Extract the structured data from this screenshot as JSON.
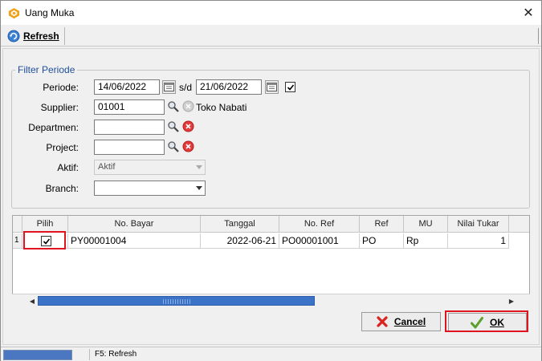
{
  "window": {
    "title": "Uang Muka",
    "close_glyph": "✕"
  },
  "toolbar": {
    "refresh_label": "Refresh"
  },
  "filter": {
    "legend": "Filter Periode",
    "periode_label": "Periode:",
    "date_from": "14/06/2022",
    "sd_label": "s/d",
    "date_to": "21/06/2022",
    "periode_checked": true,
    "supplier_label": "Supplier:",
    "supplier_code": "01001",
    "supplier_name": "Toko Nabati",
    "departmen_label": "Departmen:",
    "departmen_value": "",
    "project_label": "Project:",
    "project_value": "",
    "aktif_label": "Aktif:",
    "aktif_value": "Aktif",
    "branch_label": "Branch:",
    "branch_value": ""
  },
  "grid": {
    "columns": [
      "Pilih",
      "No. Bayar",
      "Tanggal",
      "No. Ref",
      "Ref",
      "MU",
      "Nilai Tukar"
    ],
    "rows": [
      {
        "row_no": "1",
        "pilih": true,
        "no_bayar": "PY00001004",
        "tanggal": "2022-06-21",
        "no_ref": "PO00001001",
        "ref": "PO",
        "mu": "Rp",
        "nilai_tukar": "1"
      }
    ]
  },
  "buttons": {
    "cancel_label": "Cancel",
    "ok_label": "OK"
  },
  "status": {
    "progress": 1.0,
    "text": "F5: Refresh"
  },
  "colors": {
    "accent": "#1f4e9c",
    "highlight": "#e0141e",
    "progress": "#4b77c2"
  }
}
